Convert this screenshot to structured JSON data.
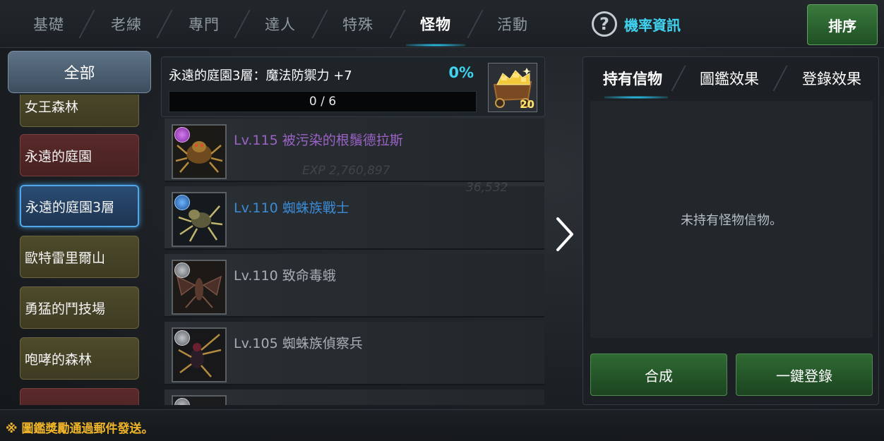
{
  "top_tabs": [
    {
      "label": "基礎",
      "active": false
    },
    {
      "label": "老練",
      "active": false
    },
    {
      "label": "專門",
      "active": false
    },
    {
      "label": "達人",
      "active": false
    },
    {
      "label": "特殊",
      "active": false
    },
    {
      "label": "怪物",
      "active": true
    },
    {
      "label": "活動",
      "active": false
    }
  ],
  "header": {
    "rate_info_label": "機率資訊",
    "sort_label": "排序",
    "help_icon": "?"
  },
  "sidebar": {
    "all_label": "全部",
    "items": [
      {
        "label": "女王森林",
        "style": "olive"
      },
      {
        "label": "永遠的庭園",
        "style": "red"
      },
      {
        "label": "永遠的庭園3層",
        "style": "active"
      },
      {
        "label": "歐特雷里爾山",
        "style": "olive"
      },
      {
        "label": "勇猛的鬥技場",
        "style": "olive"
      },
      {
        "label": "咆哮的森林",
        "style": "olive"
      },
      {
        "label": "",
        "style": "red"
      }
    ]
  },
  "collection": {
    "title": "永遠的庭園3層：魔法防禦力 +7",
    "percent": "0%",
    "progress_text": "0 / 6",
    "progress_fraction": 0,
    "reward_count": "20",
    "reward_icon": "gold-cart-icon"
  },
  "monsters": [
    {
      "name": "Lv.115 被污染的根鬚德拉斯",
      "color": "#9b63c6",
      "badge": "purple"
    },
    {
      "name": "Lv.110 蜘蛛族戰士",
      "color": "#3c8bd6",
      "badge": "blue"
    },
    {
      "name": "Lv.110 致命毒蛾",
      "color": "#a7adb2",
      "badge": "gray"
    },
    {
      "name": "Lv.105 蜘蛛族偵察兵",
      "color": "#a7adb2",
      "badge": "gray"
    },
    {
      "name": "",
      "color": "#a7adb2",
      "badge": "gray"
    }
  ],
  "background_overlay": {
    "exp_text": "EXP 2,760,897",
    "gold_text": "36,532"
  },
  "right_panel": {
    "tabs": [
      {
        "label": "持有信物",
        "active": true
      },
      {
        "label": "圖鑑效果",
        "active": false
      },
      {
        "label": "登錄效果",
        "active": false
      }
    ],
    "empty_message": "未持有怪物信物。",
    "combine_label": "合成",
    "register_all_label": "一鍵登錄"
  },
  "footer": {
    "note": "※ 圖鑑獎勵通過郵件發送。"
  },
  "colors": {
    "accent_cyan": "#3fd3f0",
    "button_green": "#2f6a33",
    "footer_note": "#f0b429"
  }
}
